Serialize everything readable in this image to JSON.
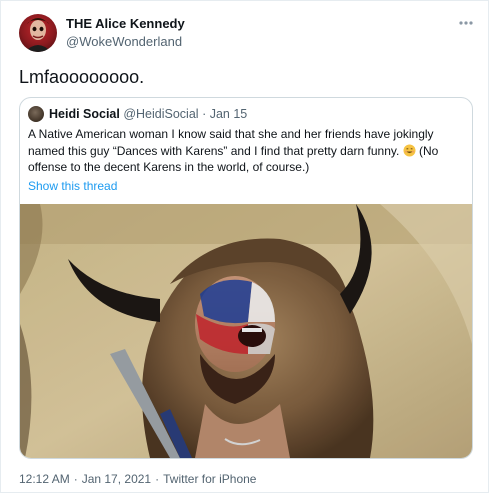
{
  "author": {
    "name": "THE Alice Kennedy",
    "handle": "@WokeWonderland"
  },
  "tweet": {
    "text": "Lmfaoooooooo."
  },
  "quoted": {
    "name": "Heidi Social",
    "handle": "@HeidiSocial",
    "separator": "·",
    "date": "Jan 15",
    "text_before_emoji": "A Native American woman I know said that she and her friends have jokingly named this guy “Dances with Karens” and I find that pretty darn funny. ",
    "emoji": "smiling-face-emoji",
    "text_after_emoji": " (No offense to the decent Karens in the world, of course.)",
    "show_thread": "Show this thread",
    "image_alt_icon": "photo"
  },
  "footer": {
    "time": "12:12 AM",
    "separator": "·",
    "date": "Jan 17, 2021",
    "source": "Twitter for iPhone"
  },
  "colors": {
    "link": "#1d9bf0",
    "secondary_text": "#536471",
    "border": "#cfd9de"
  },
  "icons": {
    "more": "more-dots-icon"
  }
}
